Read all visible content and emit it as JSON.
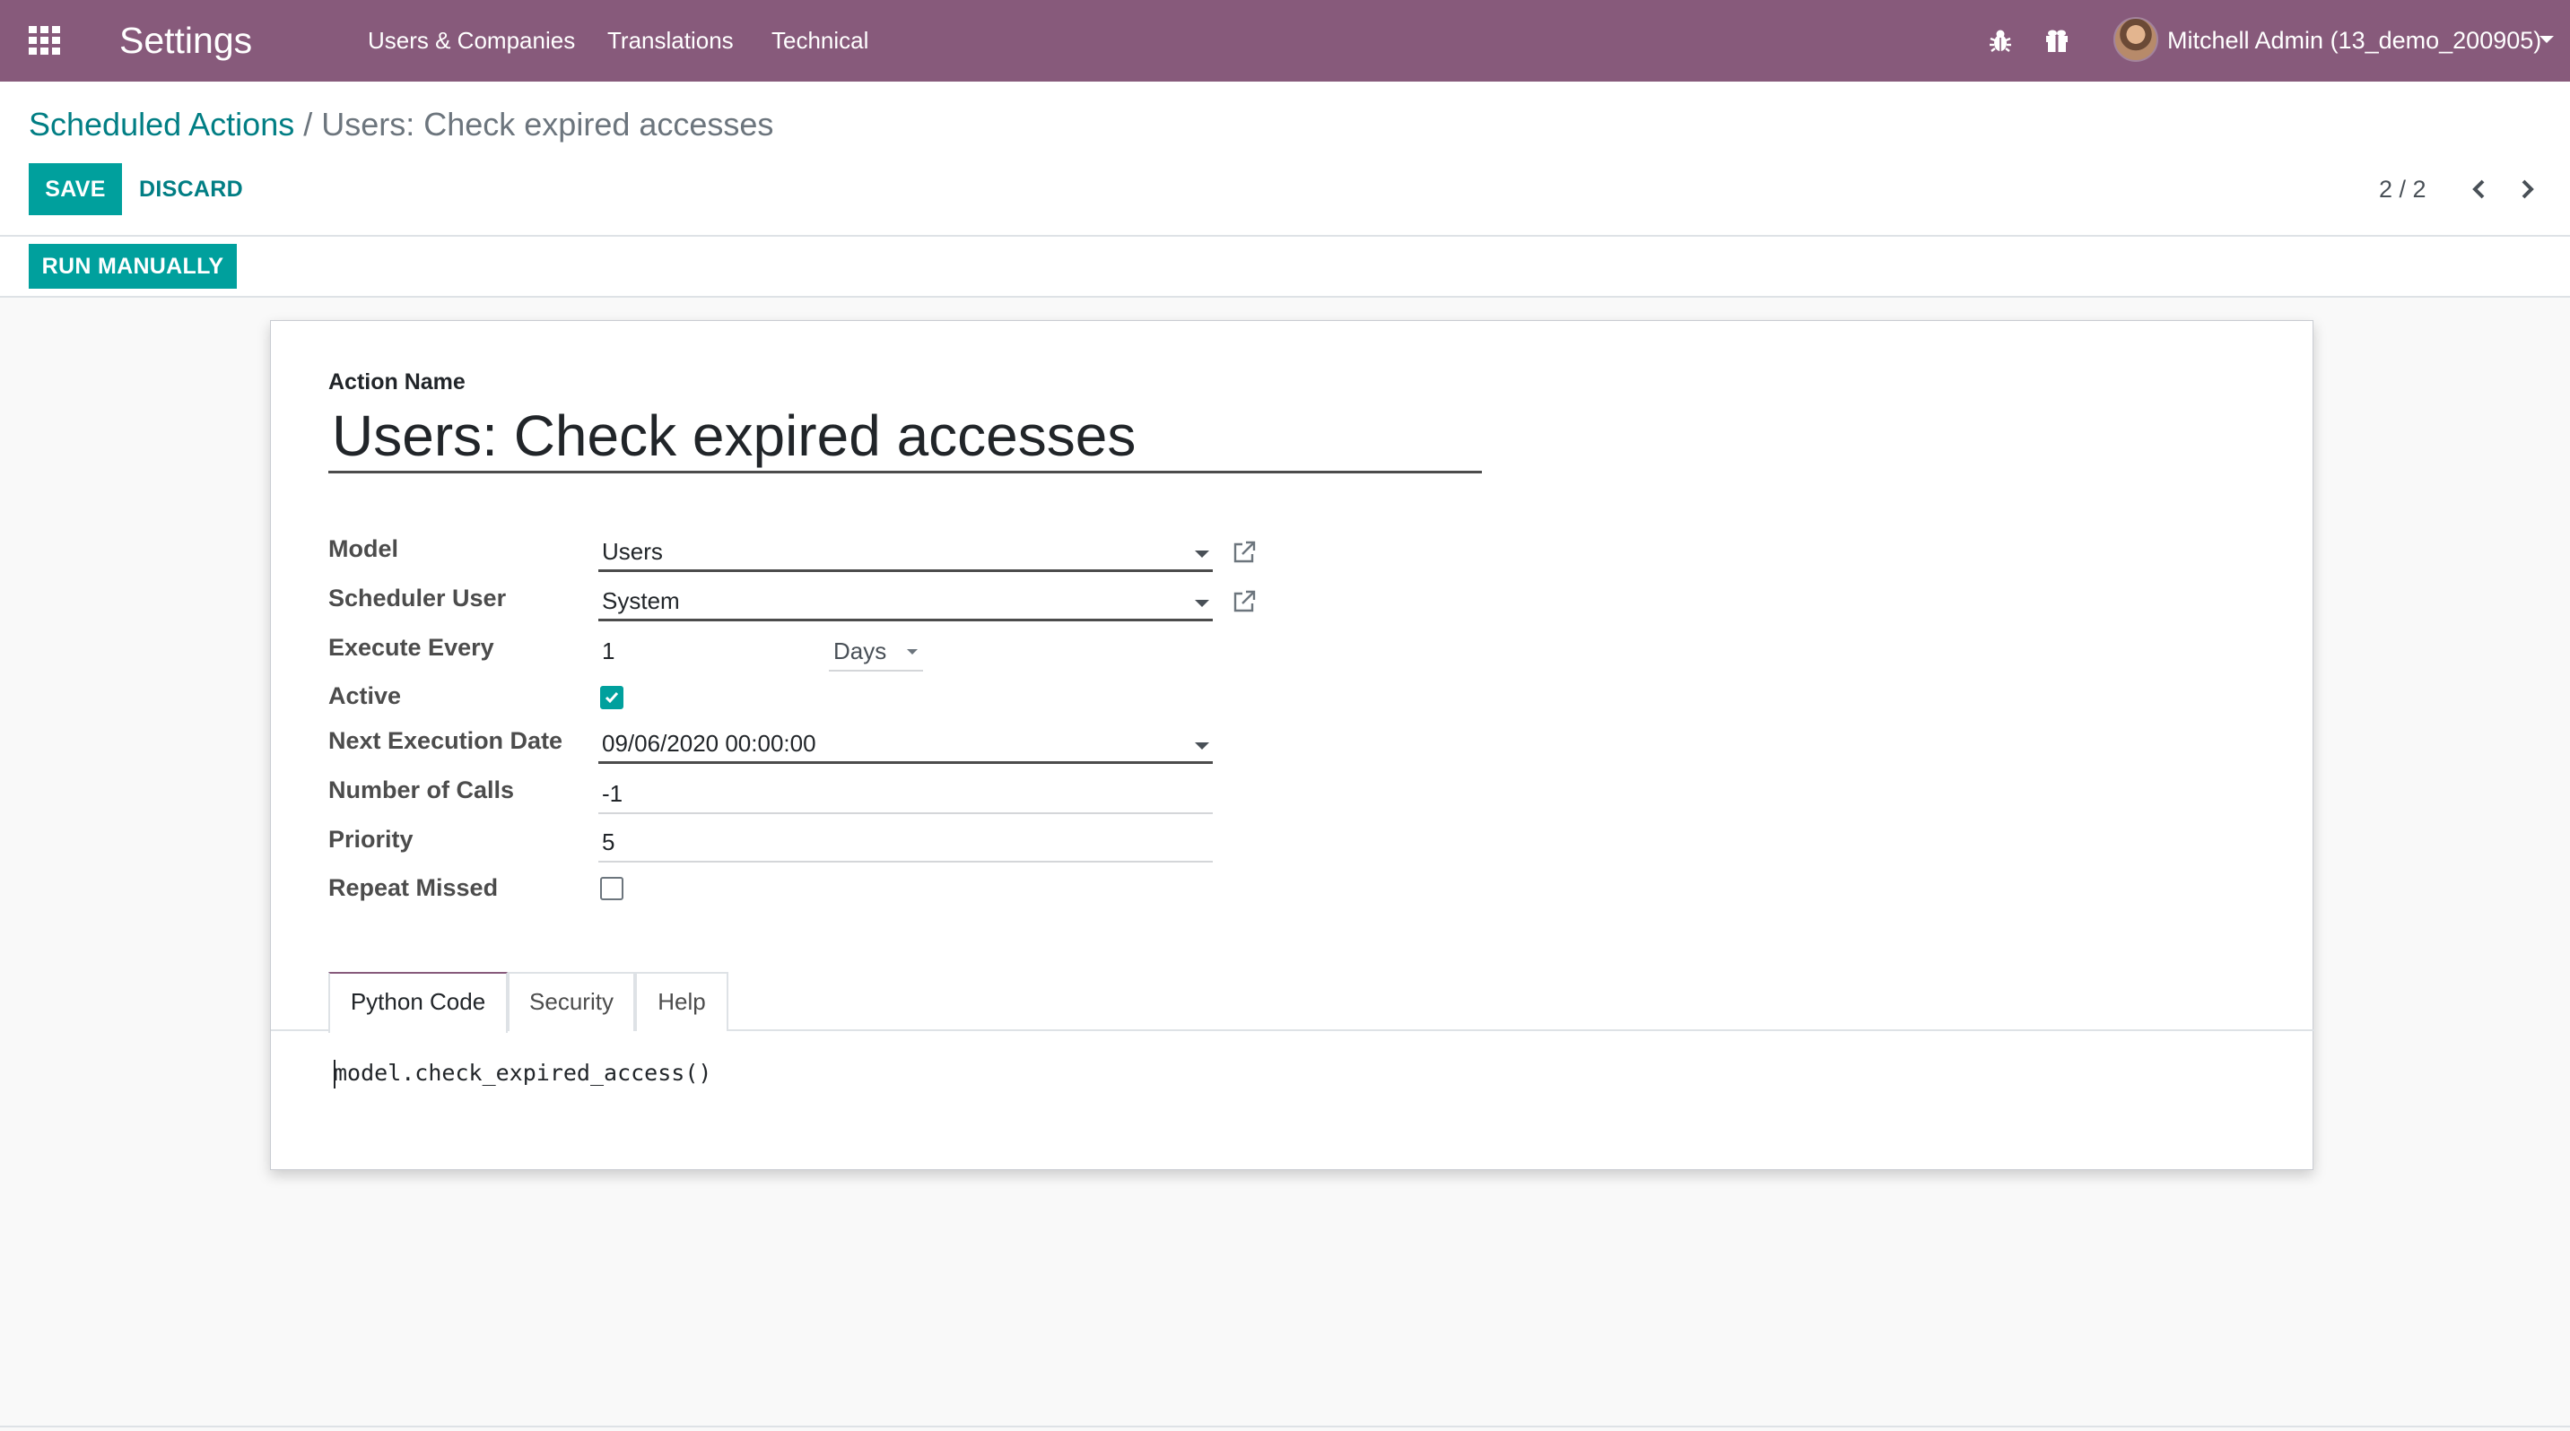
{
  "navbar": {
    "brand": "Settings",
    "menus": [
      "Users & Companies",
      "Translations",
      "Technical"
    ],
    "user": "Mitchell Admin (13_demo_200905)",
    "icons": [
      "apps-grid-icon",
      "bug-icon",
      "gift-icon",
      "user-avatar",
      "caret-down-icon"
    ]
  },
  "breadcrumb": {
    "parent": "Scheduled Actions",
    "separator": "/",
    "current": "Users: Check expired accesses"
  },
  "buttons": {
    "save": "SAVE",
    "discard": "DISCARD",
    "run_manually": "RUN MANUALLY"
  },
  "pager": {
    "value": "2 / 2"
  },
  "form": {
    "name_label": "Action Name",
    "name_value": "Users: Check expired accesses",
    "fields": {
      "model": {
        "label": "Model",
        "value": "Users"
      },
      "scheduler_user": {
        "label": "Scheduler User",
        "value": "System"
      },
      "execute_every": {
        "label": "Execute Every",
        "value": "1",
        "unit": "Days"
      },
      "active": {
        "label": "Active",
        "checked": true
      },
      "next_execution": {
        "label": "Next Execution Date",
        "value": "09/06/2020 00:00:00"
      },
      "number_of_calls": {
        "label": "Number of Calls",
        "value": "-1"
      },
      "priority": {
        "label": "Priority",
        "value": "5"
      },
      "repeat_missed": {
        "label": "Repeat Missed",
        "checked": false
      }
    },
    "tabs": [
      {
        "label": "Python Code",
        "active": true
      },
      {
        "label": "Security",
        "active": false
      },
      {
        "label": "Help",
        "active": false
      }
    ],
    "code": "model.check_expired_access()"
  },
  "colors": {
    "navbar": "#875a7b",
    "primary": "#00a09d",
    "link": "#017e84"
  }
}
